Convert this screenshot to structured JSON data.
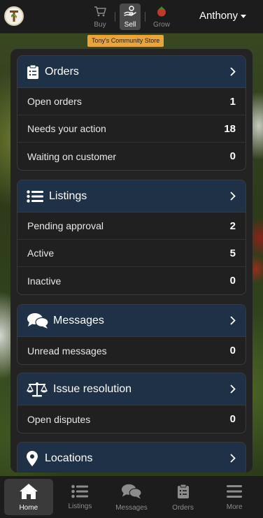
{
  "header": {
    "modes": [
      {
        "label": "Buy",
        "icon": "cart-icon",
        "active": false
      },
      {
        "label": "Sell",
        "icon": "hand-coin-icon",
        "active": true
      },
      {
        "label": "Grow",
        "icon": "tomato-icon",
        "active": false
      }
    ],
    "store_name": "Tony's Community Store",
    "user_name": "Anthony"
  },
  "cards": {
    "orders": {
      "title": "Orders",
      "icon": "clipboard-icon",
      "rows": [
        {
          "label": "Open orders",
          "value": "1"
        },
        {
          "label": "Needs your action",
          "value": "18"
        },
        {
          "label": "Waiting on customer",
          "value": "0"
        }
      ]
    },
    "listings": {
      "title": "Listings",
      "icon": "list-icon",
      "rows": [
        {
          "label": "Pending approval",
          "value": "2"
        },
        {
          "label": "Active",
          "value": "5"
        },
        {
          "label": "Inactive",
          "value": "0"
        }
      ]
    },
    "messages": {
      "title": "Messages",
      "icon": "chat-bubbles-icon",
      "rows": [
        {
          "label": "Unread messages",
          "value": "0"
        }
      ]
    },
    "issues": {
      "title": "Issue resolution",
      "icon": "scale-icon",
      "rows": [
        {
          "label": "Open disputes",
          "value": "0"
        }
      ]
    },
    "locations": {
      "title": "Locations",
      "icon": "map-pin-icon"
    }
  },
  "bottom_nav": [
    {
      "label": "Home",
      "icon": "home-icon",
      "active": true
    },
    {
      "label": "Listings",
      "icon": "list-icon",
      "active": false
    },
    {
      "label": "Messages",
      "icon": "chat-bubbles-icon",
      "active": false
    },
    {
      "label": "Orders",
      "icon": "clipboard-icon",
      "active": false
    },
    {
      "label": "More",
      "icon": "hamburger-icon",
      "active": false
    }
  ],
  "colors": {
    "card_header": "#1e3146",
    "store_badge": "#e9a43a",
    "panel": "#232323",
    "topbar": "#1c1c1c"
  }
}
